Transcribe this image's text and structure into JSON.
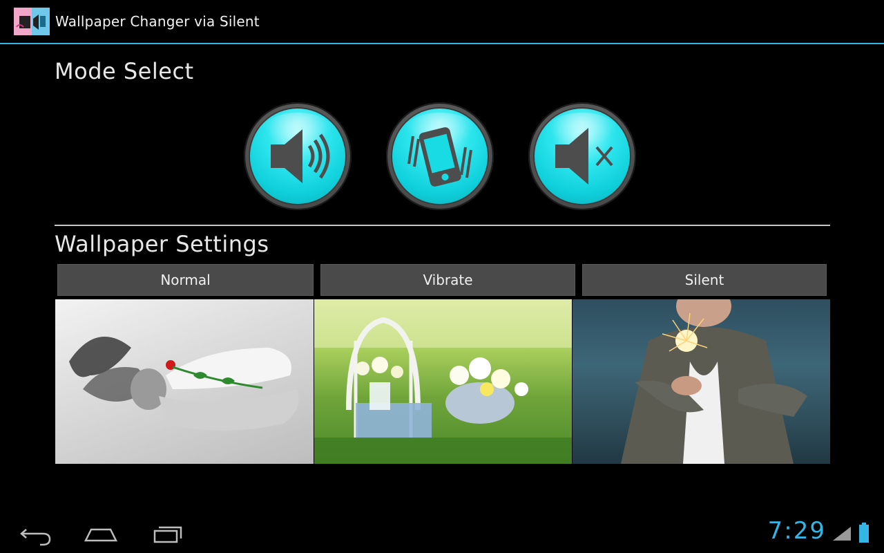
{
  "app": {
    "title": "Wallpaper Changer via Silent",
    "icon": "wallpaper-changer-app-icon"
  },
  "mode_select": {
    "title": "Mode Select",
    "buttons": [
      {
        "id": "normal",
        "icon": "speaker-sound-icon"
      },
      {
        "id": "vibrate",
        "icon": "phone-vibrate-icon"
      },
      {
        "id": "silent",
        "icon": "speaker-mute-icon"
      }
    ],
    "accent_color": "#19dbe4"
  },
  "wallpaper_settings": {
    "title": "Wallpaper Settings",
    "buttons": [
      {
        "label": "Normal"
      },
      {
        "label": "Vibrate"
      },
      {
        "label": "Silent"
      }
    ],
    "previews": [
      {
        "mode": "normal",
        "icon": "woman-with-rose-photo"
      },
      {
        "mode": "vibrate",
        "icon": "flowers-on-chair-photo"
      },
      {
        "mode": "silent",
        "icon": "woman-with-sparkler-photo"
      }
    ]
  },
  "status_bar": {
    "time": "7:29",
    "accent_color": "#33b5e5"
  },
  "navigation": {
    "back_icon": "back-icon",
    "home_icon": "home-icon",
    "recent_icon": "recent-apps-icon"
  }
}
